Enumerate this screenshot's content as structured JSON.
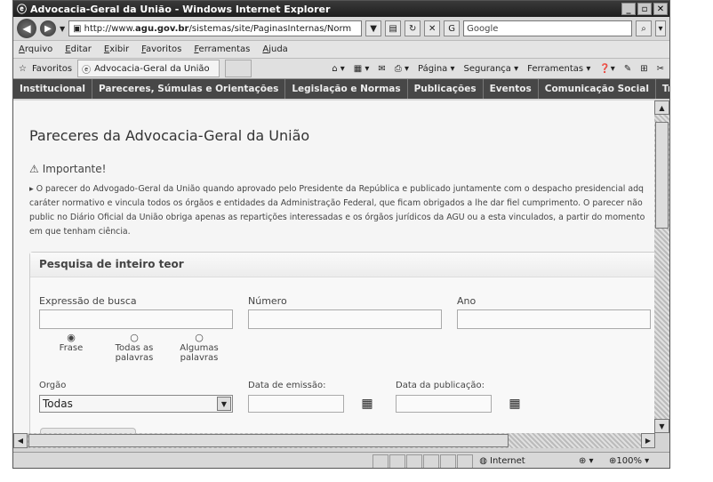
{
  "window": {
    "title": "Advocacia-Geral da União - Windows Internet Explorer"
  },
  "browser": {
    "url_prefix": "http://www.",
    "url_domain": "agu.gov.br",
    "url_rest": "/sistemas/site/PaginasInternas/Norm",
    "search_placeholder": "Google",
    "menu": [
      "Arquivo",
      "Editar",
      "Exibir",
      "Favoritos",
      "Ferramentas",
      "Ajuda"
    ],
    "favorites_label": "Favoritos",
    "tab_label": "Advocacia-Geral da União",
    "toolbar": {
      "page": "Página",
      "security": "Segurança",
      "tools": "Ferramentas"
    },
    "status": {
      "zone": "Internet",
      "zoom": "100%"
    }
  },
  "site_nav": [
    "Institucional",
    "Pareceres, Súmulas e Orientações",
    "Legislação e Normas",
    "Publicações",
    "Eventos",
    "Comunicação Social",
    "Transparê"
  ],
  "page": {
    "title": "Pareceres da Advocacia-Geral da União",
    "important_label": "Importante!",
    "important_text": "O parecer do Advogado-Geral da União quando aprovado pelo Presidente da República e publicado juntamente com o despacho presidencial adq caráter normativo e vincula todos os órgãos e entidades da Administração Federal, que ficam obrigados a lhe dar fiel cumprimento. O parecer não public no Diário Oficial da União obriga apenas as repartições interessadas e os órgãos jurídicos da AGU ou a esta vinculados, a partir do momento em que tenham ciência."
  },
  "search_panel": {
    "title": "Pesquisa de inteiro teor",
    "expression_label": "Expressão de busca",
    "number_label": "Número",
    "year_label": "Ano",
    "radios": [
      "Frase",
      "Todas as palavras",
      "Algumas palavras"
    ],
    "org_label": "Orgão",
    "org_value": "Todas",
    "emission_label": "Data de emissão:",
    "publication_label": "Data da publicação:"
  }
}
